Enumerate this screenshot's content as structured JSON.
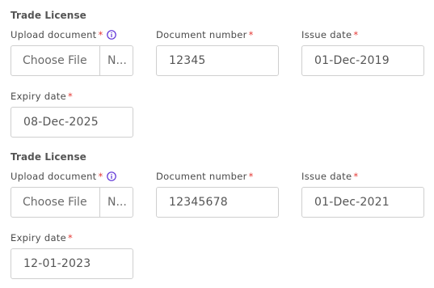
{
  "sections": [
    {
      "title": "Trade License",
      "upload": {
        "label": "Upload document",
        "button": "Choose File",
        "file_name": "N..."
      },
      "document_number": {
        "label": "Document number",
        "value": "12345"
      },
      "issue_date": {
        "label": "Issue date",
        "value": "01-Dec-2019"
      },
      "expiry_date": {
        "label": "Expiry date",
        "value": "08-Dec-2025"
      }
    },
    {
      "title": "Trade License",
      "upload": {
        "label": "Upload document",
        "button": "Choose File",
        "file_name": "N..."
      },
      "document_number": {
        "label": "Document number",
        "value": "12345678"
      },
      "issue_date": {
        "label": "Issue date",
        "value": "01-Dec-2021"
      },
      "expiry_date": {
        "label": "Expiry date",
        "value": "12-01-2023"
      }
    }
  ],
  "required_marker": "*",
  "colors": {
    "required": "#e53935",
    "info_icon": "#5b2fd6",
    "border": "#cfcfcf"
  }
}
